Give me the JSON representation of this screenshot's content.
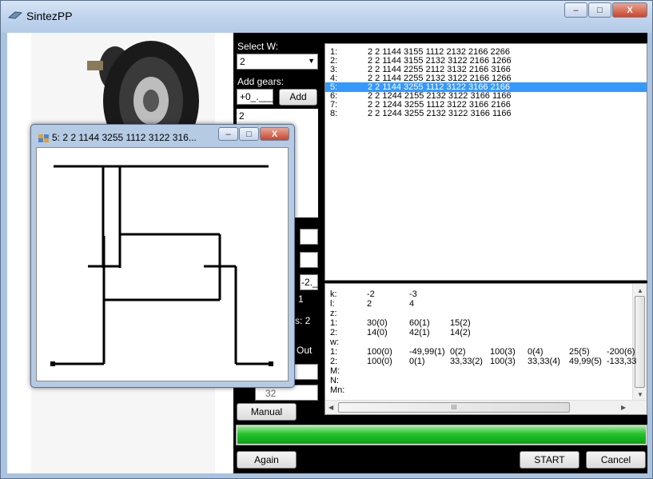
{
  "window": {
    "title": "SintezPP",
    "minimize": "–",
    "maximize": "□",
    "close": "X"
  },
  "controls": {
    "select_w_label": "Select W:",
    "select_w_value": "2",
    "add_gears_label": "Add gears:",
    "gear_input_value": "+0_.___",
    "add_button": "Add",
    "gear_list_value": "2",
    "field_value": "-2._",
    "one_label": "1",
    "s2_label": "s: 2",
    "out_label": "Out",
    "field_32": "32",
    "manual_button": "Manual",
    "again_button": "Again",
    "start_button": "START",
    "cancel_button": "Cancel",
    "progress_fraction": 1.0
  },
  "variants": {
    "selected_index": 4,
    "items": [
      {
        "num": "1:",
        "text": "2 2 1144 3155 1112 2132 2166 2266"
      },
      {
        "num": "2:",
        "text": "2 2 1144 3155 2132 3122 2166 1266"
      },
      {
        "num": "3:",
        "text": "2 2 1144 2255 2112 3132 2166 3166"
      },
      {
        "num": "4:",
        "text": "2 2 1144 2255 2132 3122 2166 1266"
      },
      {
        "num": "5:",
        "text": "2 2 1144 3255 1112 3122 3166 2166"
      },
      {
        "num": "6:",
        "text": "2 2 1244 2155 2132 3122 3166 1166"
      },
      {
        "num": "7:",
        "text": "2 2 1244 3255 1112 3122 3166 2166"
      },
      {
        "num": "8:",
        "text": "2 2 1244 3255 2132 3122 3166 1166"
      }
    ]
  },
  "grid": {
    "rows": [
      [
        "k:",
        "-2",
        "-3"
      ],
      [
        "l:",
        "2",
        "4"
      ],
      [
        "z:"
      ],
      [
        "1:",
        "30(0)",
        "60(1)",
        "15(2)"
      ],
      [
        "2:",
        "14(0)",
        "42(1)",
        "14(2)"
      ],
      [
        "w:"
      ],
      [
        "1:",
        "100(0)",
        "-49,99(1)",
        "0(2)",
        "100(3)",
        "0(4)",
        "25(5)",
        "-200(6)"
      ],
      [
        "2:",
        "100(0)",
        "0(1)",
        "33,33(2)",
        "100(3)",
        "33,33(4)",
        "49,99(5)",
        "-133,33"
      ],
      [
        "M:"
      ],
      [
        "N:"
      ],
      [
        "Mn:"
      ]
    ],
    "hscroll_glyph": "III"
  },
  "scheme_window": {
    "title": "5: 2 2 1144 3255 1112 3122 316...",
    "minimize": "–",
    "maximize": "□",
    "close": "X"
  }
}
